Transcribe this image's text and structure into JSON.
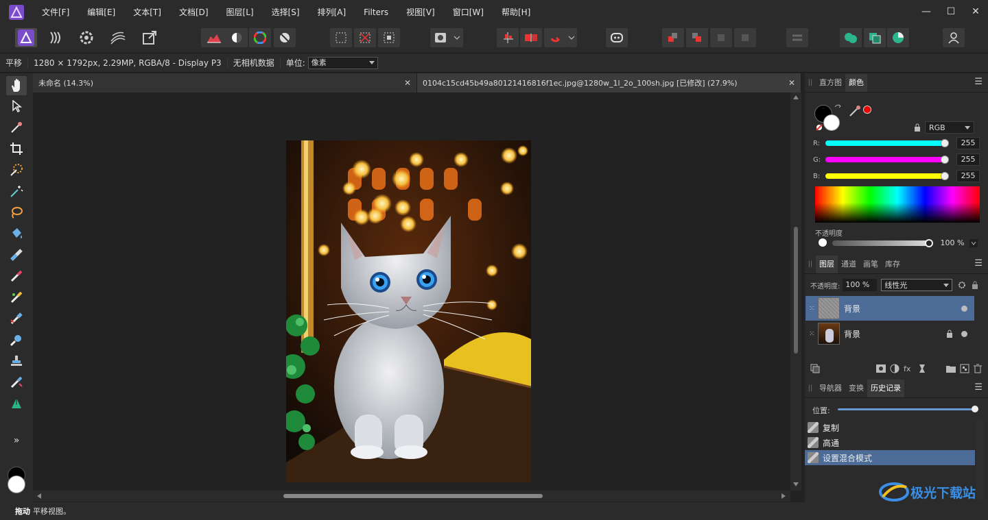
{
  "menubar": {
    "items": [
      "文件[F]",
      "编辑[E]",
      "文本[T]",
      "文档[D]",
      "图层[L]",
      "选择[S]",
      "排列[A]",
      "Filters",
      "视图[V]",
      "窗口[W]",
      "帮助[H]"
    ],
    "window_controls": [
      "—",
      "☐",
      "✕"
    ]
  },
  "context": {
    "tool": "平移",
    "doc_info": "1280 × 1792px, 2.29MP, RGBA/8 - Display P3",
    "camera": "无相机数据",
    "unit_label": "单位:",
    "unit_value": "像素"
  },
  "tabs": [
    {
      "title": "未命名 (14.3%)",
      "close": "✕"
    },
    {
      "title": "0104c15cd45b49a80121416816f1ec.jpg@1280w_1l_2o_100sh.jpg [已修改] (27.9%)",
      "close": "✕"
    }
  ],
  "color_panel": {
    "tabs": [
      "直方图",
      "颜色"
    ],
    "active_tab": "颜色",
    "mode": "RGB",
    "sliders": [
      {
        "label": "R:",
        "value": "255",
        "color": "#00ffff"
      },
      {
        "label": "G:",
        "value": "255",
        "color": "#ff00ff"
      },
      {
        "label": "B:",
        "value": "255",
        "color": "#ffff00"
      }
    ],
    "opacity_label": "不透明度",
    "opacity_value": "100 %"
  },
  "layers_panel": {
    "tabs": [
      "图层",
      "通道",
      "画笔",
      "库存"
    ],
    "active_tab": "图层",
    "opacity_label": "不透明度:",
    "opacity_value": "100 %",
    "blend_mode": "线性光",
    "layers": [
      {
        "name": "背景",
        "selected": true
      },
      {
        "name": "背景",
        "selected": false
      }
    ]
  },
  "history_panel": {
    "tabs": [
      "导航器",
      "变换",
      "历史记录"
    ],
    "active_tab": "历史记录",
    "position_label": "位置:",
    "items": [
      "复制",
      "高通",
      "设置混合模式"
    ],
    "selected_index": 2
  },
  "status": {
    "bold": "拖动",
    "text": "平移视图。"
  },
  "watermark": "极光下载站",
  "colors": {
    "accent": "#7b4cc9",
    "selection": "#4c6b96",
    "panel_bg": "#2b2b2b"
  }
}
